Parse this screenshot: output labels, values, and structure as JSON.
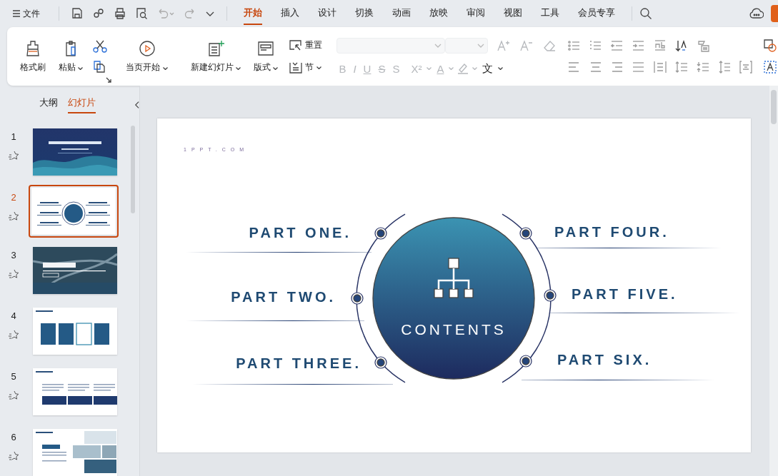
{
  "menu": {
    "label": "文件"
  },
  "tabs": [
    {
      "label": "开始",
      "selected": true
    },
    {
      "label": "插入",
      "selected": false
    },
    {
      "label": "设计",
      "selected": false
    },
    {
      "label": "切换",
      "selected": false
    },
    {
      "label": "动画",
      "selected": false
    },
    {
      "label": "放映",
      "selected": false
    },
    {
      "label": "审阅",
      "selected": false
    },
    {
      "label": "视图",
      "selected": false
    },
    {
      "label": "工具",
      "selected": false
    },
    {
      "label": "会员专享",
      "selected": false
    }
  ],
  "ribbon": {
    "format_painter": "格式刷",
    "paste": "粘贴",
    "start_show": "当页开始",
    "new_slide": "新建幻灯片",
    "layout": "版式",
    "reset": "重置",
    "section": "节",
    "font_buttons": [
      {
        "label": "B",
        "disabled": true
      },
      {
        "label": "I",
        "disabled": true
      },
      {
        "label": "U",
        "disabled": true
      },
      {
        "label": "S",
        "disabled": true
      },
      {
        "label": "S",
        "disabled": true
      },
      {
        "label": "X²",
        "disabled": true
      },
      {
        "label": "A",
        "disabled": true
      },
      {
        "label": "文",
        "disabled": false
      }
    ]
  },
  "panel_tabs": [
    {
      "label": "大纲",
      "selected": false
    },
    {
      "label": "幻灯片",
      "selected": true
    }
  ],
  "slides": [
    {
      "number": "1",
      "selected": false,
      "kind": "title"
    },
    {
      "number": "2",
      "selected": true,
      "kind": "contents"
    },
    {
      "number": "3",
      "selected": false,
      "kind": "section"
    },
    {
      "number": "4",
      "selected": false,
      "kind": "cards"
    },
    {
      "number": "5",
      "selected": false,
      "kind": "columns"
    },
    {
      "number": "6",
      "selected": false,
      "kind": "photos"
    }
  ],
  "slide": {
    "site": "1PPT.COM",
    "center": "CONTENTS",
    "parts": [
      {
        "label": "PART ONE."
      },
      {
        "label": "PART TWO."
      },
      {
        "label": "PART THREE."
      },
      {
        "label": "PART FOUR."
      },
      {
        "label": "PART FIVE."
      },
      {
        "label": "PART SIX."
      }
    ]
  }
}
